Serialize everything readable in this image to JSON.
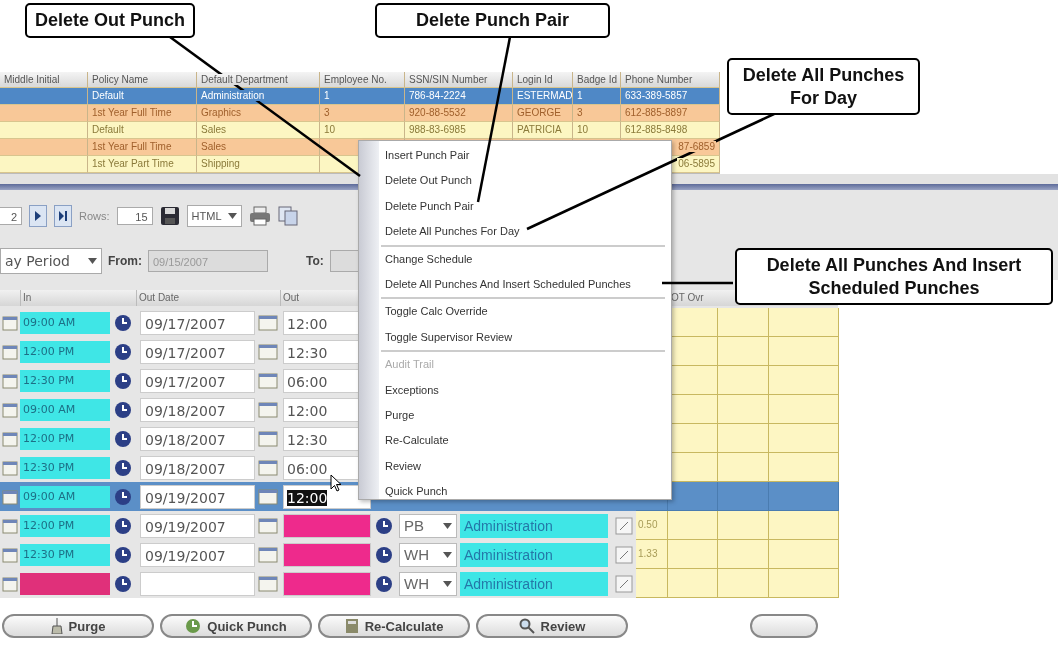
{
  "callouts": [
    {
      "text": "Delete Out Punch"
    },
    {
      "text": "Delete Punch Pair"
    },
    {
      "text": "Delete All Punches For Day"
    },
    {
      "text": "Delete All Punches And Insert Scheduled Punches"
    }
  ],
  "employee_grid": {
    "columns": [
      "Middle Initial",
      "Policy Name",
      "Default Department",
      "Employee No.",
      "SSN/SIN Number",
      "Login Id",
      "Badge Id",
      "Phone Number"
    ],
    "rows": [
      {
        "selected": true,
        "policy_name": "Default",
        "department": "Administration",
        "employee_no": "1",
        "ssn": "786-84-2224",
        "login_id": "ESTERMAD",
        "badge_id": "1",
        "phone": "633-389-5857"
      },
      {
        "selected": false,
        "policy_name": "1st Year Full Time",
        "department": "Graphics",
        "employee_no": "3",
        "ssn": "920-88-5532",
        "login_id": "GEORGE",
        "badge_id": "3",
        "phone": "612-885-8897"
      },
      {
        "selected": false,
        "policy_name": "Default",
        "department": "Sales",
        "employee_no": "10",
        "ssn": "988-83-6985",
        "login_id": "PATRICIA",
        "badge_id": "10",
        "phone": "612-885-8498"
      },
      {
        "selected": false,
        "policy_name": "1st Year Full Time",
        "department": "Sales",
        "phone": "87-6859"
      },
      {
        "selected": false,
        "policy_name": "1st Year Part Time",
        "department": "Shipping",
        "phone": "06-5895"
      }
    ]
  },
  "toolbar": {
    "page": "2",
    "rows_label": "Rows:",
    "rows": "15",
    "format": "HTML"
  },
  "filter": {
    "period": "ay Period",
    "from_label": "From:",
    "from": "09/15/2007",
    "to_label": "To:"
  },
  "punch_grid": {
    "columns": {
      "in": "In",
      "out_date": "Out Date",
      "out": "Out",
      "ot_override": "OT Ovr"
    },
    "rows": [
      {
        "selected": false,
        "in_time": "09:00 AM",
        "in_exception": false,
        "out_date": "09/17/2007",
        "out_time": "12:00",
        "out_highlight": false,
        "out_exception": false
      },
      {
        "selected": false,
        "in_time": "12:00 PM",
        "in_exception": false,
        "out_date": "09/17/2007",
        "out_time": "12:30",
        "out_highlight": false,
        "out_exception": false
      },
      {
        "selected": false,
        "in_time": "12:30 PM",
        "in_exception": false,
        "out_date": "09/17/2007",
        "out_time": "06:00",
        "out_highlight": false,
        "out_exception": false
      },
      {
        "selected": false,
        "in_time": "09:00 AM",
        "in_exception": false,
        "out_date": "09/18/2007",
        "out_time": "12:00",
        "out_highlight": false,
        "out_exception": false
      },
      {
        "selected": false,
        "in_time": "12:00 PM",
        "in_exception": false,
        "out_date": "09/18/2007",
        "out_time": "12:30",
        "out_highlight": false,
        "out_exception": false
      },
      {
        "selected": false,
        "in_time": "12:30 PM",
        "in_exception": false,
        "out_date": "09/18/2007",
        "out_time": "06:00",
        "out_highlight": false,
        "out_exception": false
      },
      {
        "selected": true,
        "in_time": "09:00 AM",
        "in_exception": false,
        "out_date": "09/19/2007",
        "out_time": "12:00",
        "out_highlight": true,
        "out_exception": false
      },
      {
        "selected": false,
        "in_time": "12:00 PM",
        "in_exception": false,
        "out_date": "09/19/2007",
        "out_exception": true,
        "pay_code": "PB",
        "department": "Administration",
        "hours": "0.50"
      },
      {
        "selected": false,
        "in_time": "12:30 PM",
        "in_exception": false,
        "out_date": "09/19/2007",
        "out_exception": true,
        "pay_code": "WH",
        "department": "Administration",
        "hours": "1.33"
      },
      {
        "selected": false,
        "in_exception": true,
        "out_exception": true,
        "pay_code": "WH",
        "department": "Administration"
      }
    ]
  },
  "context_menu": [
    {
      "kind": "item",
      "label": "Insert Punch Pair",
      "disabled": false
    },
    {
      "kind": "item",
      "label": "Delete Out Punch",
      "disabled": false
    },
    {
      "kind": "item",
      "label": "Delete Punch Pair",
      "disabled": false
    },
    {
      "kind": "item",
      "label": "Delete All Punches For Day",
      "disabled": false
    },
    {
      "kind": "separator"
    },
    {
      "kind": "item",
      "label": "Change Schedule",
      "disabled": false
    },
    {
      "kind": "item",
      "label": "Delete All Punches And Insert Scheduled Punches",
      "disabled": false
    },
    {
      "kind": "separator"
    },
    {
      "kind": "item",
      "label": "Toggle Calc Override",
      "disabled": false
    },
    {
      "kind": "item",
      "label": "Toggle Supervisor Review",
      "disabled": false
    },
    {
      "kind": "separator"
    },
    {
      "kind": "item",
      "label": "Audit Trail",
      "disabled": true
    },
    {
      "kind": "item",
      "label": "Exceptions",
      "disabled": false
    },
    {
      "kind": "item",
      "label": "Purge",
      "disabled": false
    },
    {
      "kind": "item",
      "label": "Re-Calculate",
      "disabled": false
    },
    {
      "kind": "item",
      "label": "Review",
      "disabled": false
    },
    {
      "kind": "item",
      "label": "Quick Punch",
      "disabled": false
    }
  ],
  "bottom_buttons": [
    {
      "label": "Purge"
    },
    {
      "label": "Quick Punch"
    },
    {
      "label": "Re-Calculate"
    },
    {
      "label": "Review"
    }
  ]
}
